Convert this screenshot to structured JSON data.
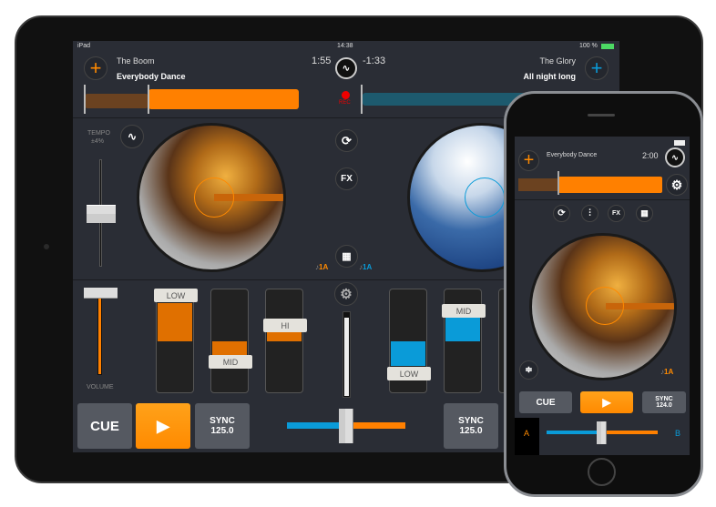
{
  "ipad": {
    "status": {
      "device": "iPad",
      "time": "14:38",
      "battery": "100 %"
    },
    "deck_a": {
      "artist": "The Boom",
      "title": "Everybody Dance",
      "elapsed": "1:55",
      "key": "1A",
      "tempo_label": "TEMPO",
      "tempo_range": "±4%",
      "sync_label": "SYNC",
      "bpm": "125.0",
      "accent": "#ff8a00"
    },
    "deck_b": {
      "artist": "The Glory",
      "title": "All night long",
      "remaining": "-1:33",
      "key": "1A",
      "sync_label": "SYNC",
      "bpm": "125.0",
      "accent": "#0a9bd8"
    },
    "rec_label": "REC",
    "center_buttons": {
      "loop_icon": "loop-icon",
      "fx_label": "FX",
      "grid_icon": "grid-icon",
      "settings_icon": "gear-icon"
    },
    "mixer": {
      "volume_label": "VOLUME",
      "eq_a": [
        {
          "label": "LOW"
        },
        {
          "label": "MID"
        },
        {
          "label": "HI"
        }
      ],
      "eq_b": [
        {
          "label": "LOW"
        },
        {
          "label": "MID"
        }
      ]
    },
    "transport": {
      "cue_label": "CUE",
      "play_icon": "play-icon"
    }
  },
  "iphone": {
    "title": "Everybody Dance",
    "time": "2:00",
    "key": "1A",
    "fx_label": "FX",
    "cue_label": "CUE",
    "sync_label": "SYNC",
    "bpm": "124.0",
    "crossfader_a": "A",
    "crossfader_b": "B"
  }
}
